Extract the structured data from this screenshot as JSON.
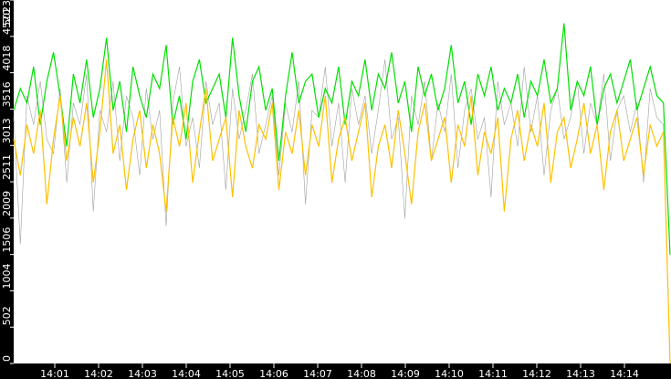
{
  "chart_data": {
    "type": "line",
    "title": "",
    "xlabel": "",
    "ylabel": "",
    "ylim": [
      0,
      5023
    ],
    "xlim_minutes": [
      0,
      15
    ],
    "y_ticks": [
      "0",
      "502",
      "1004",
      "1506",
      "2009",
      "2511",
      "3013",
      "3516",
      "4018",
      "4520",
      "5023"
    ],
    "y_tick_values": [
      0,
      502,
      1004,
      1506,
      2009,
      2511,
      3013,
      3516,
      4018,
      4520,
      5023
    ],
    "x_ticks": [
      "14:01",
      "14:02",
      "14:03",
      "14:04",
      "14:05",
      "14:06",
      "14:07",
      "14:08",
      "14:09",
      "14:10",
      "14:11",
      "14:12",
      "14:13",
      "14:14"
    ],
    "x_tick_minutes": [
      1,
      2,
      3,
      4,
      5,
      6,
      7,
      8,
      9,
      10,
      11,
      12,
      13,
      14
    ],
    "grid": false,
    "series": [
      {
        "name": "gray",
        "color": "#a0a0a0",
        "values": [
          3400,
          1650,
          3700,
          3300,
          3900,
          3100,
          2900,
          3800,
          2500,
          3600,
          3300,
          4000,
          2100,
          3500,
          3200,
          3900,
          2800,
          3700,
          3400,
          2600,
          3800,
          3100,
          3500,
          1900,
          3600,
          4100,
          3000,
          3400,
          2700,
          3900,
          3300,
          3600,
          2400,
          3800,
          3100,
          3500,
          4000,
          2900,
          3300,
          3700,
          2600,
          3600,
          3200,
          3900,
          2200,
          3500,
          3400,
          4100,
          3000,
          3600,
          2500,
          3800,
          3300,
          3700,
          2900,
          3500,
          4200,
          3100,
          3400,
          2000,
          3700,
          3300,
          3900,
          2800,
          3600,
          3200,
          4000,
          2700,
          3500,
          3800,
          3100,
          3400,
          2300,
          3900,
          3300,
          3600,
          3000,
          4100,
          3200,
          3700,
          2600,
          3500,
          3800,
          3100,
          3400,
          3900,
          2900,
          3600,
          3300,
          4000,
          2800,
          3500,
          3700,
          3200,
          3600,
          2500,
          3800,
          3400,
          3300,
          0
        ]
      },
      {
        "name": "green",
        "color": "#00e000",
        "values": [
          3500,
          3800,
          3600,
          4100,
          3300,
          3900,
          4300,
          3700,
          3000,
          4000,
          3600,
          4200,
          3400,
          3800,
          4500,
          3500,
          3900,
          3200,
          4100,
          3700,
          3400,
          4000,
          3800,
          4400,
          3300,
          3700,
          3100,
          3900,
          4200,
          3600,
          3800,
          4000,
          3400,
          4500,
          3700,
          3200,
          3900,
          4100,
          3500,
          3800,
          2800,
          3700,
          4300,
          3600,
          3900,
          4000,
          3400,
          3800,
          3600,
          4100,
          3300,
          3900,
          3700,
          4200,
          3500,
          4000,
          3800,
          4300,
          3600,
          3900,
          3200,
          4100,
          3700,
          4000,
          3500,
          3800,
          4400,
          3600,
          3900,
          3300,
          4000,
          3700,
          4100,
          3500,
          3800,
          3600,
          4000,
          3400,
          3900,
          3700,
          4200,
          3600,
          3800,
          4700,
          3500,
          3900,
          3700,
          4100,
          3300,
          3800,
          4000,
          3600,
          3900,
          4200,
          3500,
          3800,
          4100,
          3700,
          3600,
          1500
        ]
      },
      {
        "name": "orange",
        "color": "#ffc000",
        "values": [
          3100,
          2600,
          3300,
          2900,
          3500,
          2200,
          3100,
          3700,
          2800,
          3400,
          3000,
          3600,
          2500,
          3200,
          4200,
          2900,
          3300,
          2400,
          3100,
          3500,
          2700,
          3300,
          2900,
          2100,
          3400,
          3000,
          3600,
          2500,
          3200,
          3800,
          2800,
          3100,
          3400,
          2300,
          3500,
          3000,
          2700,
          3300,
          3100,
          3600,
          2400,
          3200,
          2900,
          3500,
          2600,
          3300,
          3000,
          3700,
          2500,
          3100,
          3400,
          2800,
          3200,
          3600,
          2300,
          3000,
          3300,
          2700,
          3500,
          2900,
          2200,
          3200,
          3600,
          2800,
          3100,
          3400,
          2500,
          3300,
          3000,
          3700,
          2600,
          3200,
          2900,
          3400,
          2100,
          3100,
          3500,
          2800,
          3300,
          3000,
          3600,
          2500,
          3200,
          3400,
          2700,
          3100,
          3600,
          2900,
          3300,
          2400,
          3200,
          3500,
          2800,
          3100,
          3400,
          2600,
          3300,
          3000,
          3200,
          0
        ]
      }
    ]
  }
}
